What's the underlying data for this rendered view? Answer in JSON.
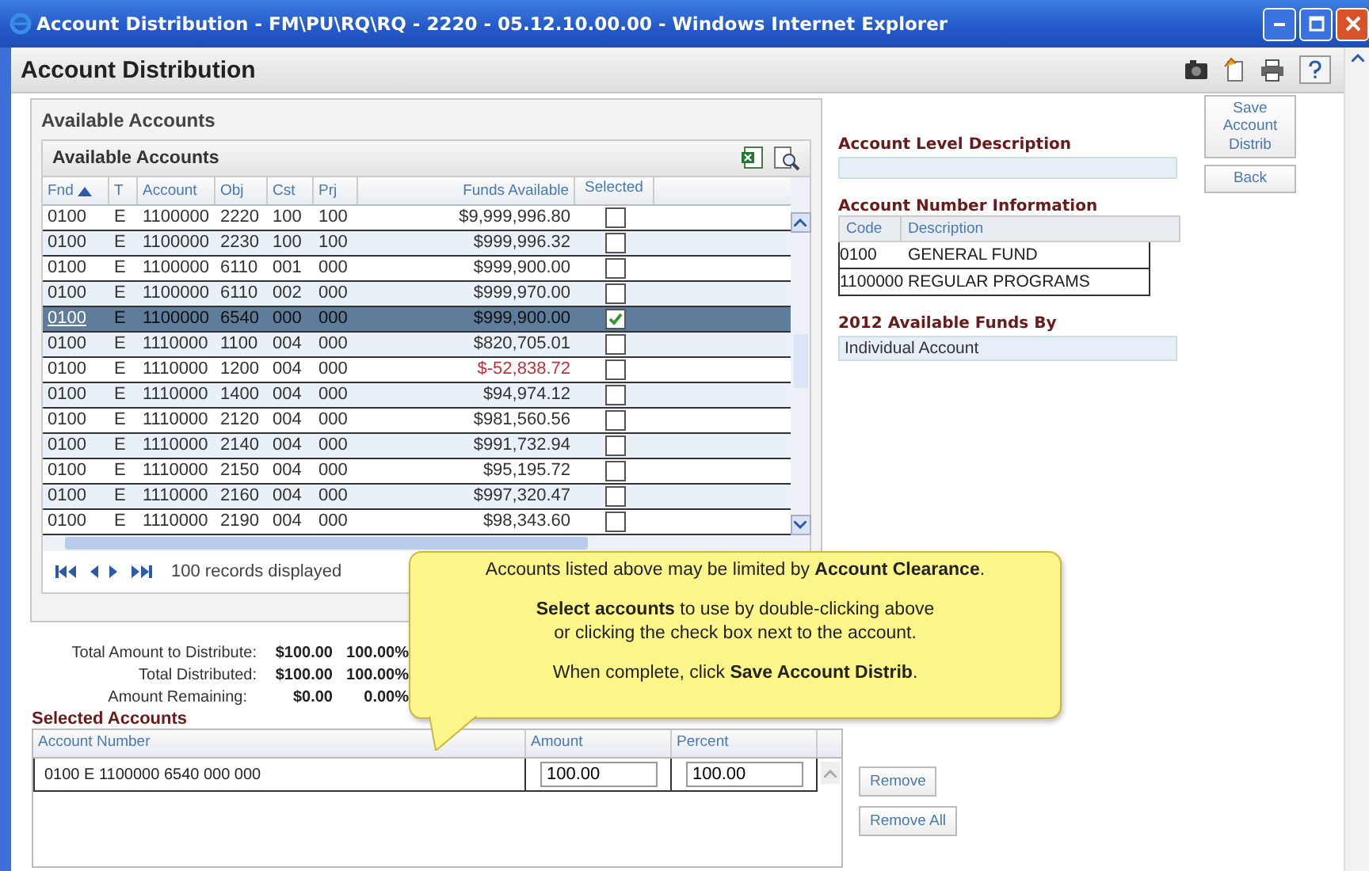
{
  "window": {
    "title": "Account Distribution - FM\\PU\\RQ\\RQ - 2220 - 05.12.10.00.00 - Windows Internet Explorer"
  },
  "page_title": "Account Distribution",
  "available": {
    "section_label": "Available Accounts",
    "grid_title": "Available Accounts",
    "columns": [
      {
        "label": "Fnd",
        "sorted": true
      },
      {
        "label": "T",
        "sorted": false
      },
      {
        "label": "Account",
        "sorted": false
      },
      {
        "label": "Obj",
        "sorted": false
      },
      {
        "label": "Cst",
        "sorted": false
      },
      {
        "label": "Prj",
        "sorted": false
      },
      {
        "label": "Funds Available",
        "sorted": false
      },
      {
        "label": "Selected",
        "sorted": false
      }
    ],
    "rows": [
      {
        "fnd": "0100",
        "t": "E",
        "account": "1100000",
        "obj": "2220",
        "cst": "100",
        "prj": "100",
        "funds": "$9,999,996.80",
        "negative": false,
        "selected": false
      },
      {
        "fnd": "0100",
        "t": "E",
        "account": "1100000",
        "obj": "2230",
        "cst": "100",
        "prj": "100",
        "funds": "$999,996.32",
        "negative": false,
        "selected": false
      },
      {
        "fnd": "0100",
        "t": "E",
        "account": "1100000",
        "obj": "6110",
        "cst": "001",
        "prj": "000",
        "funds": "$999,900.00",
        "negative": false,
        "selected": false
      },
      {
        "fnd": "0100",
        "t": "E",
        "account": "1100000",
        "obj": "6110",
        "cst": "002",
        "prj": "000",
        "funds": "$999,970.00",
        "negative": false,
        "selected": false
      },
      {
        "fnd": "0100",
        "t": "E",
        "account": "1100000",
        "obj": "6540",
        "cst": "000",
        "prj": "000",
        "funds": "$999,900.00",
        "negative": false,
        "selected": true
      },
      {
        "fnd": "0100",
        "t": "E",
        "account": "1110000",
        "obj": "1100",
        "cst": "004",
        "prj": "000",
        "funds": "$820,705.01",
        "negative": false,
        "selected": false
      },
      {
        "fnd": "0100",
        "t": "E",
        "account": "1110000",
        "obj": "1200",
        "cst": "004",
        "prj": "000",
        "funds": "$-52,838.72",
        "negative": true,
        "selected": false
      },
      {
        "fnd": "0100",
        "t": "E",
        "account": "1110000",
        "obj": "1400",
        "cst": "004",
        "prj": "000",
        "funds": "$94,974.12",
        "negative": false,
        "selected": false
      },
      {
        "fnd": "0100",
        "t": "E",
        "account": "1110000",
        "obj": "2120",
        "cst": "004",
        "prj": "000",
        "funds": "$981,560.56",
        "negative": false,
        "selected": false
      },
      {
        "fnd": "0100",
        "t": "E",
        "account": "1110000",
        "obj": "2140",
        "cst": "004",
        "prj": "000",
        "funds": "$991,732.94",
        "negative": false,
        "selected": false
      },
      {
        "fnd": "0100",
        "t": "E",
        "account": "1110000",
        "obj": "2150",
        "cst": "004",
        "prj": "000",
        "funds": "$95,195.72",
        "negative": false,
        "selected": false
      },
      {
        "fnd": "0100",
        "t": "E",
        "account": "1110000",
        "obj": "2160",
        "cst": "004",
        "prj": "000",
        "funds": "$997,320.47",
        "negative": false,
        "selected": false
      },
      {
        "fnd": "0100",
        "t": "E",
        "account": "1110000",
        "obj": "2190",
        "cst": "004",
        "prj": "000",
        "funds": "$98,343.60",
        "negative": false,
        "selected": false
      }
    ],
    "records": "100 records displayed"
  },
  "account_level": {
    "heading": "Account Level Description"
  },
  "account_number": {
    "heading": "Account Number Information",
    "columns": [
      "Code",
      "Description"
    ],
    "rows": [
      {
        "code": "0100",
        "description": "GENERAL FUND"
      },
      {
        "code": "1100000",
        "description": "REGULAR PROGRAMS"
      }
    ]
  },
  "funds_by": {
    "heading": "2012 Available Funds By",
    "value": "Individual Account"
  },
  "side_buttons": [
    "Save Account Distrib",
    "Back"
  ],
  "totals": [
    {
      "label": "Total Amount to Distribute:",
      "amount": "$100.00",
      "percent": "100.00%"
    },
    {
      "label": "Total Distributed:",
      "amount": "$100.00",
      "percent": "100.00%"
    },
    {
      "label": "Amount Remaining:",
      "amount": "$0.00",
      "percent": "0.00%"
    }
  ],
  "selected_accounts": {
    "heading": "Selected Accounts",
    "columns": [
      "Account Number",
      "Amount",
      "Percent"
    ],
    "rows": [
      {
        "account": "0100 E 1100000 6540 000 000",
        "amount": "100.00",
        "percent": "100.00"
      }
    ],
    "buttons": [
      "Remove",
      "Remove All"
    ]
  },
  "tooltip": [
    [
      "Accounts listed above may be limited by **Account Clearance**."
    ],
    [
      "**Select accounts** to use by double-clicking above",
      "or clicking the check box next to the account."
    ],
    [
      "When complete, click **Save Account Distrib**."
    ]
  ]
}
